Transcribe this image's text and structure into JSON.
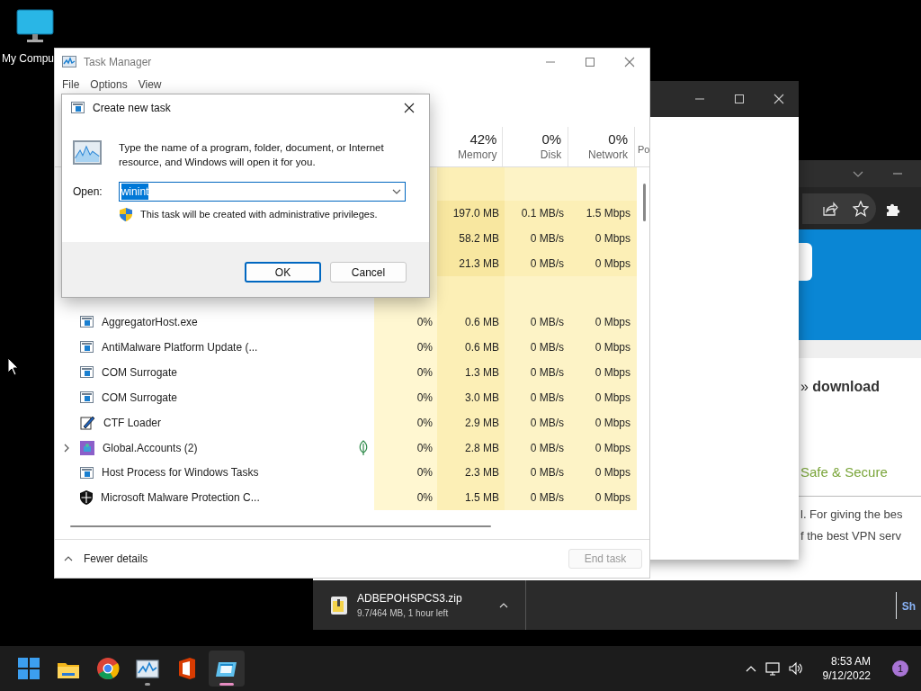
{
  "desktop_icons": [
    {
      "label": "My Compu"
    }
  ],
  "browser": {
    "breadcrumb": "» **download**",
    "tagline": "Safe & Secure",
    "text_lines": [
      "l. For giving the bes",
      "f the best VPN serv"
    ],
    "download": {
      "file": "ADBEPOHSPCS3.zip",
      "status": "9.7/464 MB, 1 hour left"
    },
    "link_text": "Sh"
  },
  "task_manager": {
    "title": "Task Manager",
    "menu": [
      "File",
      "Options",
      "View"
    ],
    "columns": [
      {
        "percent": "42%",
        "label": "Memory"
      },
      {
        "percent": "0%",
        "label": "Disk"
      },
      {
        "percent": "0%",
        "label": "Network"
      },
      {
        "label": "Po"
      }
    ],
    "app_rows": [
      {
        "memory": "197.0 MB",
        "disk": "0.1 MB/s",
        "network": "1.5 Mbps"
      },
      {
        "memory": "58.2 MB",
        "disk": "0 MB/s",
        "network": "0 Mbps"
      },
      {
        "memory": "21.3 MB",
        "disk": "0 MB/s",
        "network": "0 Mbps"
      }
    ],
    "background_rows": [
      {
        "kind": "app",
        "name": "AggregatorHost.exe",
        "expandable": false,
        "eco": false,
        "cpu": "0%",
        "memory": "0.6 MB",
        "disk": "0 MB/s",
        "network": "0 Mbps"
      },
      {
        "kind": "app",
        "name": "AntiMalware Platform Update (...",
        "expandable": false,
        "eco": false,
        "cpu": "0%",
        "memory": "0.6 MB",
        "disk": "0 MB/s",
        "network": "0 Mbps"
      },
      {
        "kind": "app",
        "name": "COM Surrogate",
        "expandable": false,
        "eco": false,
        "cpu": "0%",
        "memory": "1.3 MB",
        "disk": "0 MB/s",
        "network": "0 Mbps"
      },
      {
        "kind": "app",
        "name": "COM Surrogate",
        "expandable": false,
        "eco": false,
        "cpu": "0%",
        "memory": "3.0 MB",
        "disk": "0 MB/s",
        "network": "0 Mbps"
      },
      {
        "kind": "pen",
        "name": "CTF Loader",
        "expandable": false,
        "eco": false,
        "cpu": "0%",
        "memory": "2.9 MB",
        "disk": "0 MB/s",
        "network": "0 Mbps"
      },
      {
        "kind": "accounts",
        "name": "Global.Accounts (2)",
        "expandable": true,
        "eco": true,
        "cpu": "0%",
        "memory": "2.8 MB",
        "disk": "0 MB/s",
        "network": "0 Mbps"
      },
      {
        "kind": "app",
        "name": "Host Process for Windows Tasks",
        "expandable": false,
        "eco": false,
        "cpu": "0%",
        "memory": "2.3 MB",
        "disk": "0 MB/s",
        "network": "0 Mbps"
      },
      {
        "kind": "shield",
        "name": "Microsoft Malware Protection C...",
        "expandable": false,
        "eco": false,
        "cpu": "0%",
        "memory": "1.5 MB",
        "disk": "0 MB/s",
        "network": "0 Mbps"
      }
    ],
    "footer": {
      "toggle": "Fewer details",
      "end_task": "End task",
      "end_task_disabled": true
    }
  },
  "dialog": {
    "title": "Create new task",
    "message": "Type the name of a program, folder, document, or Internet resource, and Windows will open it for you.",
    "open_label": "Open:",
    "value": "winint",
    "text_selected": true,
    "admin_note": "This task will be created with administrative privileges.",
    "buttons": [
      {
        "label": "OK",
        "default": true
      },
      {
        "label": "Cancel",
        "default": false
      }
    ]
  },
  "taskbar": {
    "apps": [
      {
        "kind": "start",
        "running": false,
        "active": false
      },
      {
        "kind": "folder",
        "running": false,
        "active": false
      },
      {
        "kind": "chrome",
        "running": false,
        "active": false
      },
      {
        "kind": "taskmgr",
        "running": true,
        "active": false
      },
      {
        "kind": "office",
        "running": false,
        "active": false
      },
      {
        "kind": "app",
        "running": true,
        "active": true
      }
    ],
    "time": "8:53 AM",
    "date": "9/12/2022",
    "notifications": "1"
  }
}
